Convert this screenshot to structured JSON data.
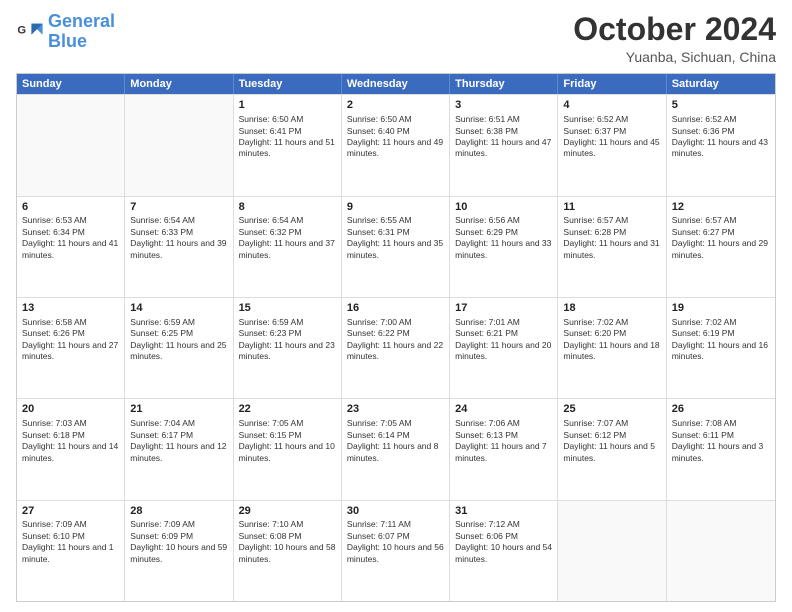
{
  "logo": {
    "text_general": "General",
    "text_blue": "Blue"
  },
  "title": "October 2024",
  "location": "Yuanba, Sichuan, China",
  "weekdays": [
    "Sunday",
    "Monday",
    "Tuesday",
    "Wednesday",
    "Thursday",
    "Friday",
    "Saturday"
  ],
  "weeks": [
    [
      {
        "day": "",
        "info": ""
      },
      {
        "day": "",
        "info": ""
      },
      {
        "day": "1",
        "info": "Sunrise: 6:50 AM\nSunset: 6:41 PM\nDaylight: 11 hours and 51 minutes."
      },
      {
        "day": "2",
        "info": "Sunrise: 6:50 AM\nSunset: 6:40 PM\nDaylight: 11 hours and 49 minutes."
      },
      {
        "day": "3",
        "info": "Sunrise: 6:51 AM\nSunset: 6:38 PM\nDaylight: 11 hours and 47 minutes."
      },
      {
        "day": "4",
        "info": "Sunrise: 6:52 AM\nSunset: 6:37 PM\nDaylight: 11 hours and 45 minutes."
      },
      {
        "day": "5",
        "info": "Sunrise: 6:52 AM\nSunset: 6:36 PM\nDaylight: 11 hours and 43 minutes."
      }
    ],
    [
      {
        "day": "6",
        "info": "Sunrise: 6:53 AM\nSunset: 6:34 PM\nDaylight: 11 hours and 41 minutes."
      },
      {
        "day": "7",
        "info": "Sunrise: 6:54 AM\nSunset: 6:33 PM\nDaylight: 11 hours and 39 minutes."
      },
      {
        "day": "8",
        "info": "Sunrise: 6:54 AM\nSunset: 6:32 PM\nDaylight: 11 hours and 37 minutes."
      },
      {
        "day": "9",
        "info": "Sunrise: 6:55 AM\nSunset: 6:31 PM\nDaylight: 11 hours and 35 minutes."
      },
      {
        "day": "10",
        "info": "Sunrise: 6:56 AM\nSunset: 6:29 PM\nDaylight: 11 hours and 33 minutes."
      },
      {
        "day": "11",
        "info": "Sunrise: 6:57 AM\nSunset: 6:28 PM\nDaylight: 11 hours and 31 minutes."
      },
      {
        "day": "12",
        "info": "Sunrise: 6:57 AM\nSunset: 6:27 PM\nDaylight: 11 hours and 29 minutes."
      }
    ],
    [
      {
        "day": "13",
        "info": "Sunrise: 6:58 AM\nSunset: 6:26 PM\nDaylight: 11 hours and 27 minutes."
      },
      {
        "day": "14",
        "info": "Sunrise: 6:59 AM\nSunset: 6:25 PM\nDaylight: 11 hours and 25 minutes."
      },
      {
        "day": "15",
        "info": "Sunrise: 6:59 AM\nSunset: 6:23 PM\nDaylight: 11 hours and 23 minutes."
      },
      {
        "day": "16",
        "info": "Sunrise: 7:00 AM\nSunset: 6:22 PM\nDaylight: 11 hours and 22 minutes."
      },
      {
        "day": "17",
        "info": "Sunrise: 7:01 AM\nSunset: 6:21 PM\nDaylight: 11 hours and 20 minutes."
      },
      {
        "day": "18",
        "info": "Sunrise: 7:02 AM\nSunset: 6:20 PM\nDaylight: 11 hours and 18 minutes."
      },
      {
        "day": "19",
        "info": "Sunrise: 7:02 AM\nSunset: 6:19 PM\nDaylight: 11 hours and 16 minutes."
      }
    ],
    [
      {
        "day": "20",
        "info": "Sunrise: 7:03 AM\nSunset: 6:18 PM\nDaylight: 11 hours and 14 minutes."
      },
      {
        "day": "21",
        "info": "Sunrise: 7:04 AM\nSunset: 6:17 PM\nDaylight: 11 hours and 12 minutes."
      },
      {
        "day": "22",
        "info": "Sunrise: 7:05 AM\nSunset: 6:15 PM\nDaylight: 11 hours and 10 minutes."
      },
      {
        "day": "23",
        "info": "Sunrise: 7:05 AM\nSunset: 6:14 PM\nDaylight: 11 hours and 8 minutes."
      },
      {
        "day": "24",
        "info": "Sunrise: 7:06 AM\nSunset: 6:13 PM\nDaylight: 11 hours and 7 minutes."
      },
      {
        "day": "25",
        "info": "Sunrise: 7:07 AM\nSunset: 6:12 PM\nDaylight: 11 hours and 5 minutes."
      },
      {
        "day": "26",
        "info": "Sunrise: 7:08 AM\nSunset: 6:11 PM\nDaylight: 11 hours and 3 minutes."
      }
    ],
    [
      {
        "day": "27",
        "info": "Sunrise: 7:09 AM\nSunset: 6:10 PM\nDaylight: 11 hours and 1 minute."
      },
      {
        "day": "28",
        "info": "Sunrise: 7:09 AM\nSunset: 6:09 PM\nDaylight: 10 hours and 59 minutes."
      },
      {
        "day": "29",
        "info": "Sunrise: 7:10 AM\nSunset: 6:08 PM\nDaylight: 10 hours and 58 minutes."
      },
      {
        "day": "30",
        "info": "Sunrise: 7:11 AM\nSunset: 6:07 PM\nDaylight: 10 hours and 56 minutes."
      },
      {
        "day": "31",
        "info": "Sunrise: 7:12 AM\nSunset: 6:06 PM\nDaylight: 10 hours and 54 minutes."
      },
      {
        "day": "",
        "info": ""
      },
      {
        "day": "",
        "info": ""
      }
    ]
  ]
}
